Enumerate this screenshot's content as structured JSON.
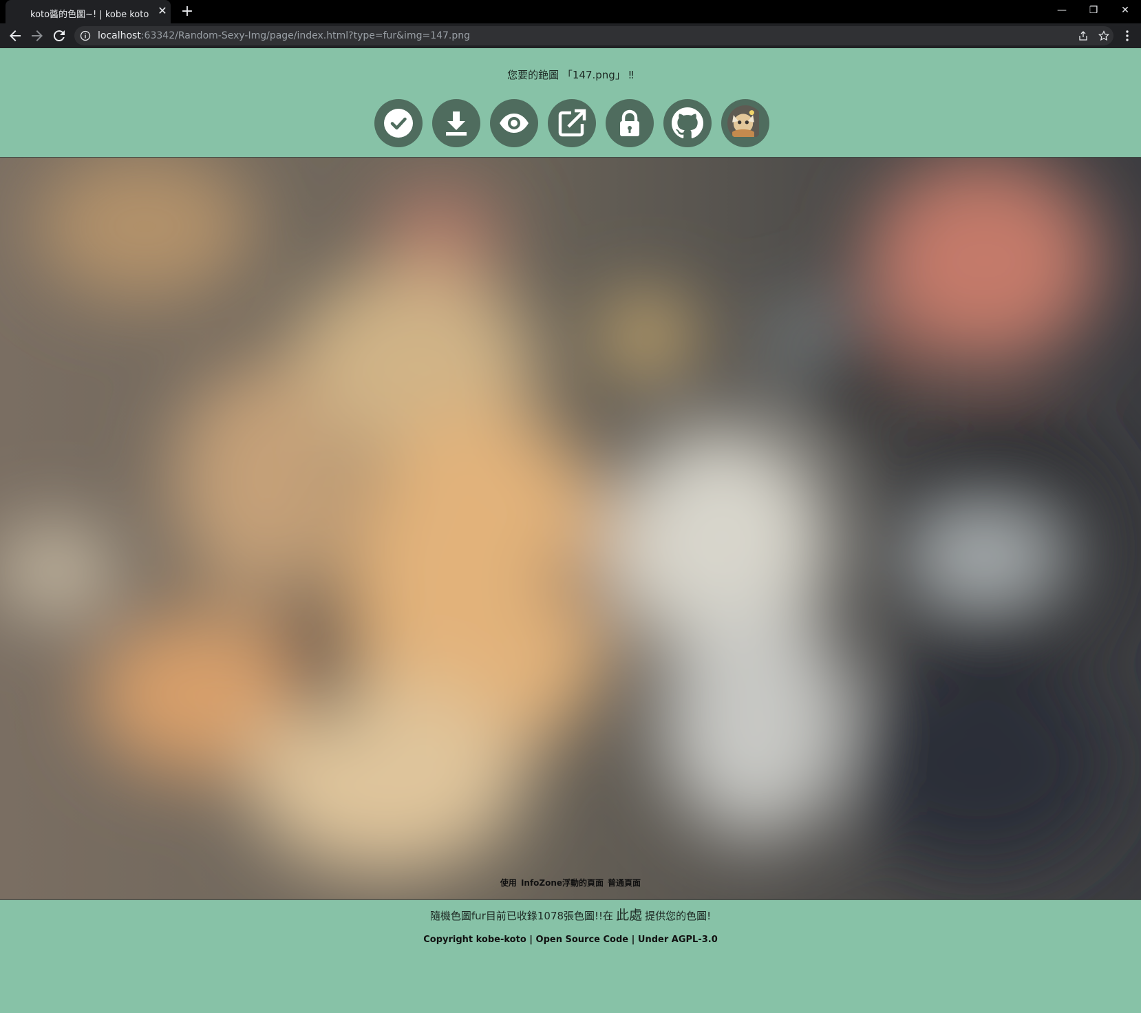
{
  "browser": {
    "tab_title": "koto醬的色圖~! | kobe koto",
    "tab_close": "✕",
    "new_tab": "+",
    "url_host": "localhost",
    "url_rest": ":63342/Random-Sexy-Img/page/index.html?type=fur&img=147.png",
    "window_controls": {
      "minimize": "—",
      "restore": "❐",
      "close": "✕"
    }
  },
  "header": {
    "text": "您要的銫圖 「147.png」 ‼"
  },
  "action_buttons": [
    {
      "name": "confirm-button",
      "icon": "check-circle-icon"
    },
    {
      "name": "download-button",
      "icon": "download-icon"
    },
    {
      "name": "view-button",
      "icon": "eye-icon"
    },
    {
      "name": "open-external-button",
      "icon": "external-link-icon"
    },
    {
      "name": "lock-button",
      "icon": "lock-icon"
    },
    {
      "name": "github-button",
      "icon": "github-icon"
    },
    {
      "name": "avatar-button",
      "icon": "avatar-image"
    }
  ],
  "image": {
    "blurred": true,
    "colors": {
      "background": "#6d685f",
      "warm": "#e2b27a",
      "light": "#d8d6cc",
      "dark": "#2a2b2f",
      "red": "#c47a6b"
    }
  },
  "footer": {
    "links_prefix": "使用",
    "link_infozone": "InfoZone浮動的頁面",
    "link_normal": "普通頁面",
    "count_text": "隨機色圖fur目前已收錄1078張色圖!!在",
    "here_link": "此處",
    "count_suffix": "提供您的色圖!",
    "copyright": "Copyright kobe-koto | Open Source Code | Under AGPL-3.0"
  },
  "colors": {
    "page_bg": "#87c2a7",
    "button_bg": "#4f6c5e",
    "chrome_bg": "#202124"
  }
}
